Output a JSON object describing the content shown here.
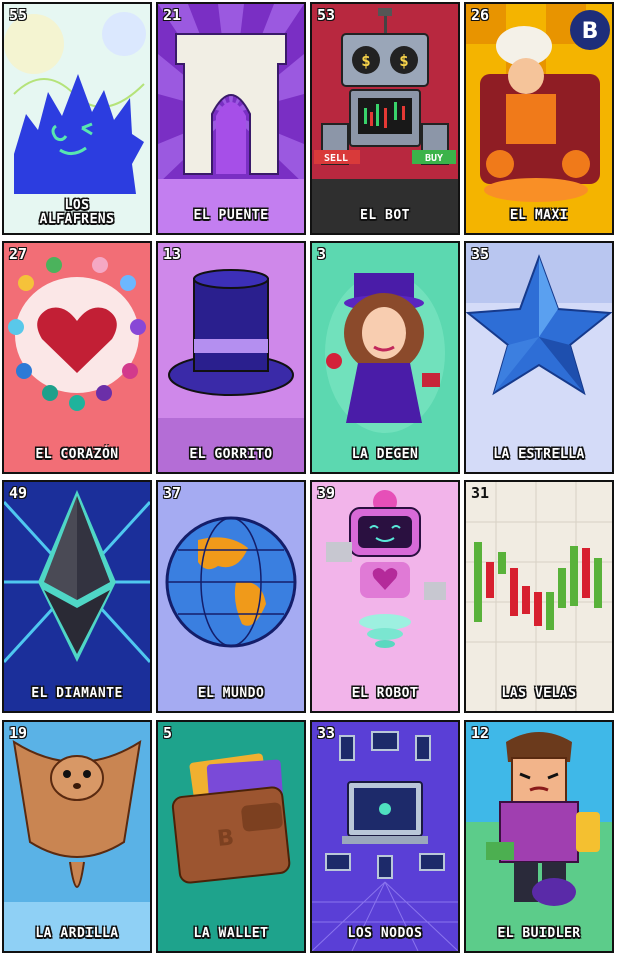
{
  "cards": [
    {
      "number": "55",
      "title": "LOS\nALFAFRENS",
      "bg": "#dff3ee"
    },
    {
      "number": "21",
      "title": "EL PUENTE",
      "bg": "#8a3fd0"
    },
    {
      "number": "53",
      "title": "EL BOT",
      "bg": "#c0344a"
    },
    {
      "number": "26",
      "title": "EL MAXI",
      "bg": "#f5b400"
    },
    {
      "number": "27",
      "title": "EL CORAZÓN",
      "bg": "#f47a82"
    },
    {
      "number": "13",
      "title": "EL GORRITO",
      "bg": "#d08be8"
    },
    {
      "number": "3",
      "title": "LA DEGEN",
      "bg": "#5fd9b2"
    },
    {
      "number": "35",
      "title": "LA ESTRELLA",
      "bg": "#cfd6f6"
    },
    {
      "number": "49",
      "title": "EL DIAMANTE",
      "bg": "#1d3aa6"
    },
    {
      "number": "37",
      "title": "EL MUNDO",
      "bg": "#9aa2f0"
    },
    {
      "number": "39",
      "title": "EL ROBOT",
      "bg": "#f2b6ea"
    },
    {
      "number": "31",
      "title": "LAS VELAS",
      "bg": "#f1ece2"
    },
    {
      "number": "19",
      "title": "LA ARDILLA",
      "bg": "#64b8e8"
    },
    {
      "number": "5",
      "title": "LA WALLET",
      "bg": "#1ea68e"
    },
    {
      "number": "33",
      "title": "LOS NODOS",
      "bg": "#5a3fd6"
    },
    {
      "number": "12",
      "title": "EL BUIDLER",
      "bg": "#5acb8a"
    }
  ]
}
